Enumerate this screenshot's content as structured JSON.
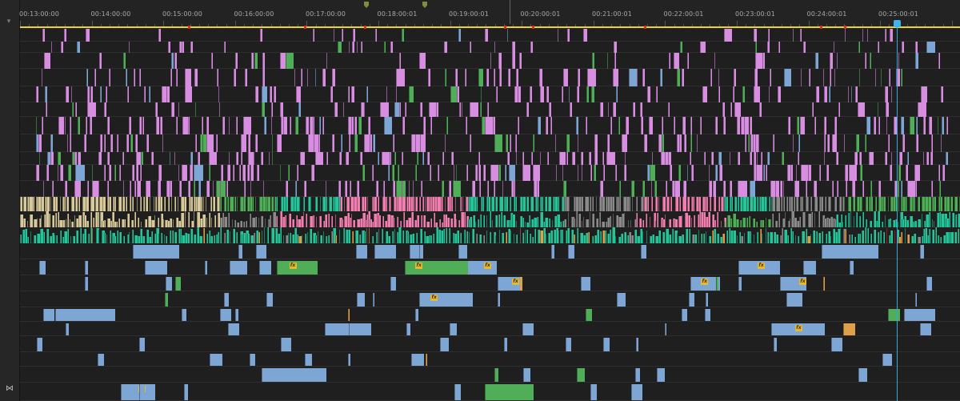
{
  "timeline": {
    "timecodes": [
      "00:13:00:00",
      "00:14:00:00",
      "00:15:00:00",
      "00:16:00:00",
      "00:17:00:00",
      "00:18:00:01",
      "00:19:00:01",
      "00:20:00:01",
      "00:21:00:01",
      "00:22:00:01",
      "00:23:00:01",
      "00:24:00:01",
      "00:25:00:01"
    ],
    "fx_label": "fx",
    "colors": {
      "violet": "#d88ee0",
      "green": "#4fae57",
      "teal": "#27c49a",
      "blue_audio": "#7ea6d4",
      "tan": "#d8c99a",
      "pink": "#ee7fae",
      "gray": "#8a8a8a",
      "orange": "#e0a04a",
      "red": "#e02a2a",
      "playhead": "#2fa8e0",
      "work_area": "#e8d43a"
    }
  },
  "gutter": {
    "toggle_icon_glyph": "⋈",
    "top_icon_glyph": "▾"
  }
}
